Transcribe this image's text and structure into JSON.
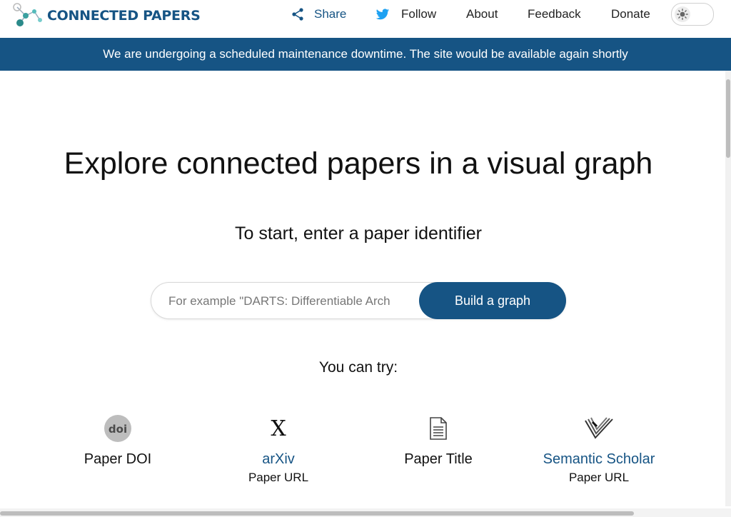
{
  "header": {
    "brand": "CONNECTED PAPERS",
    "nav": [
      {
        "label": "Share",
        "icon": "share-icon"
      },
      {
        "label": "Follow",
        "icon": "twitter-icon"
      },
      {
        "label": "About"
      },
      {
        "label": "Feedback"
      },
      {
        "label": "Donate"
      }
    ],
    "theme_toggle_icon": "sun-icon"
  },
  "banner": {
    "text": "We are undergoing a scheduled maintenance downtime. The site would be available again shortly"
  },
  "main": {
    "headline": "Explore connected papers in a visual graph",
    "subhead": "To start, enter a paper identifier",
    "search": {
      "placeholder": "For example \"DARTS: Differentiable Arch",
      "value": ""
    },
    "build_button": "Build a graph",
    "try_label": "You can try:",
    "options": [
      {
        "icon": "doi-icon",
        "icon_text": "doi",
        "title": "Paper DOI",
        "subtitle": ""
      },
      {
        "icon": "arxiv-icon",
        "icon_text": "X",
        "title": "arXiv",
        "subtitle": "Paper URL"
      },
      {
        "icon": "document-icon",
        "title": "Paper Title",
        "subtitle": ""
      },
      {
        "icon": "semantic-scholar-icon",
        "title": "Semantic Scholar",
        "subtitle": "Paper URL"
      }
    ]
  },
  "colors": {
    "brand": "#165484",
    "banner_bg": "#165484",
    "banner_text": "#ffffff",
    "link": "#165484",
    "twitter": "#1da1f2"
  }
}
